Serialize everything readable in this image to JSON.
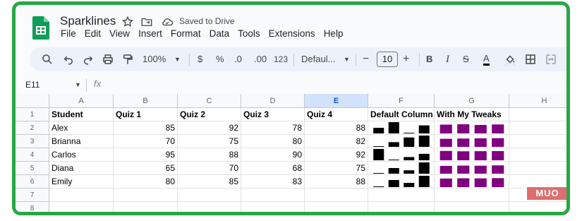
{
  "doc": {
    "title": "Sparklines",
    "saved_status": "Saved to Drive"
  },
  "menu": [
    "File",
    "Edit",
    "View",
    "Insert",
    "Format",
    "Data",
    "Tools",
    "Extensions",
    "Help"
  ],
  "toolbar": {
    "zoom": "100%",
    "currency": "$",
    "percent": "%",
    "dec_decrease": ".0",
    "dec_increase": ".00",
    "number_format": "123",
    "font": "Defaul...",
    "font_size": "10",
    "minus": "−",
    "plus": "+",
    "bold": "B",
    "italic": "I",
    "text_color": "A"
  },
  "formula_bar": {
    "cell_ref": "E11",
    "fx": "fx"
  },
  "columns": [
    "A",
    "B",
    "C",
    "D",
    "E",
    "F",
    "G",
    "H"
  ],
  "selected_column": "E",
  "rows": [
    "1",
    "2",
    "3",
    "4",
    "5",
    "6",
    "7",
    "8"
  ],
  "headers": [
    "Student",
    "Quiz 1",
    "Quiz 2",
    "Quiz 3",
    "Quiz 4",
    "Default Column",
    "With My Tweaks"
  ],
  "students": [
    {
      "name": "Alex",
      "scores": [
        85,
        92,
        78,
        88
      ]
    },
    {
      "name": "Brianna",
      "scores": [
        70,
        75,
        80,
        82
      ]
    },
    {
      "name": "Carlos",
      "scores": [
        95,
        88,
        90,
        92
      ]
    },
    {
      "name": "Diana",
      "scores": [
        65,
        70,
        68,
        75
      ]
    },
    {
      "name": "Emily",
      "scores": [
        80,
        85,
        83,
        88
      ]
    }
  ],
  "sparkline_colors": {
    "default": "#000000",
    "tweaked": "#800080"
  },
  "watermark": "MUO"
}
